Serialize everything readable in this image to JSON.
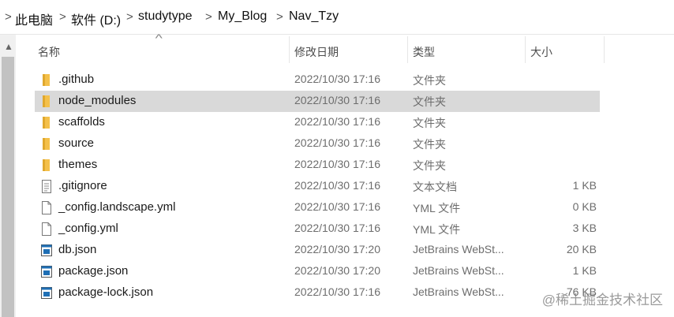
{
  "breadcrumb": {
    "items": [
      "此电脑",
      "软件 (D:)",
      "studytype",
      "My_Blog",
      "Nav_Tzy"
    ],
    "separator": ">"
  },
  "columns": {
    "name": "名称",
    "modified": "修改日期",
    "type": "类型",
    "size": "大小"
  },
  "files": [
    {
      "name": ".github",
      "modified": "2022/10/30 17:16",
      "type": "文件夹",
      "size": "",
      "kind": "folder"
    },
    {
      "name": "node_modules",
      "modified": "2022/10/30 17:16",
      "type": "文件夹",
      "size": "",
      "kind": "folder",
      "selected": true
    },
    {
      "name": "scaffolds",
      "modified": "2022/10/30 17:16",
      "type": "文件夹",
      "size": "",
      "kind": "folder"
    },
    {
      "name": "source",
      "modified": "2022/10/30 17:16",
      "type": "文件夹",
      "size": "",
      "kind": "folder"
    },
    {
      "name": "themes",
      "modified": "2022/10/30 17:16",
      "type": "文件夹",
      "size": "",
      "kind": "folder"
    },
    {
      "name": ".gitignore",
      "modified": "2022/10/30 17:16",
      "type": "文本文档",
      "size": "1 KB",
      "kind": "text"
    },
    {
      "name": "_config.landscape.yml",
      "modified": "2022/10/30 17:16",
      "type": "YML 文件",
      "size": "0 KB",
      "kind": "blank"
    },
    {
      "name": "_config.yml",
      "modified": "2022/10/30 17:16",
      "type": "YML 文件",
      "size": "3 KB",
      "kind": "blank"
    },
    {
      "name": "db.json",
      "modified": "2022/10/30 17:20",
      "type": "JetBrains WebSt...",
      "size": "20 KB",
      "kind": "json"
    },
    {
      "name": "package.json",
      "modified": "2022/10/30 17:20",
      "type": "JetBrains WebSt...",
      "size": "1 KB",
      "kind": "json"
    },
    {
      "name": "package-lock.json",
      "modified": "2022/10/30 17:16",
      "type": "JetBrains WebSt...",
      "size": "76 KB",
      "kind": "json"
    }
  ],
  "watermark": "@稀土掘金技术社区",
  "colors": {
    "folder": "#f4c04a",
    "selected_row": "#d9d9d9",
    "json_icon": "#1f6fb5"
  }
}
